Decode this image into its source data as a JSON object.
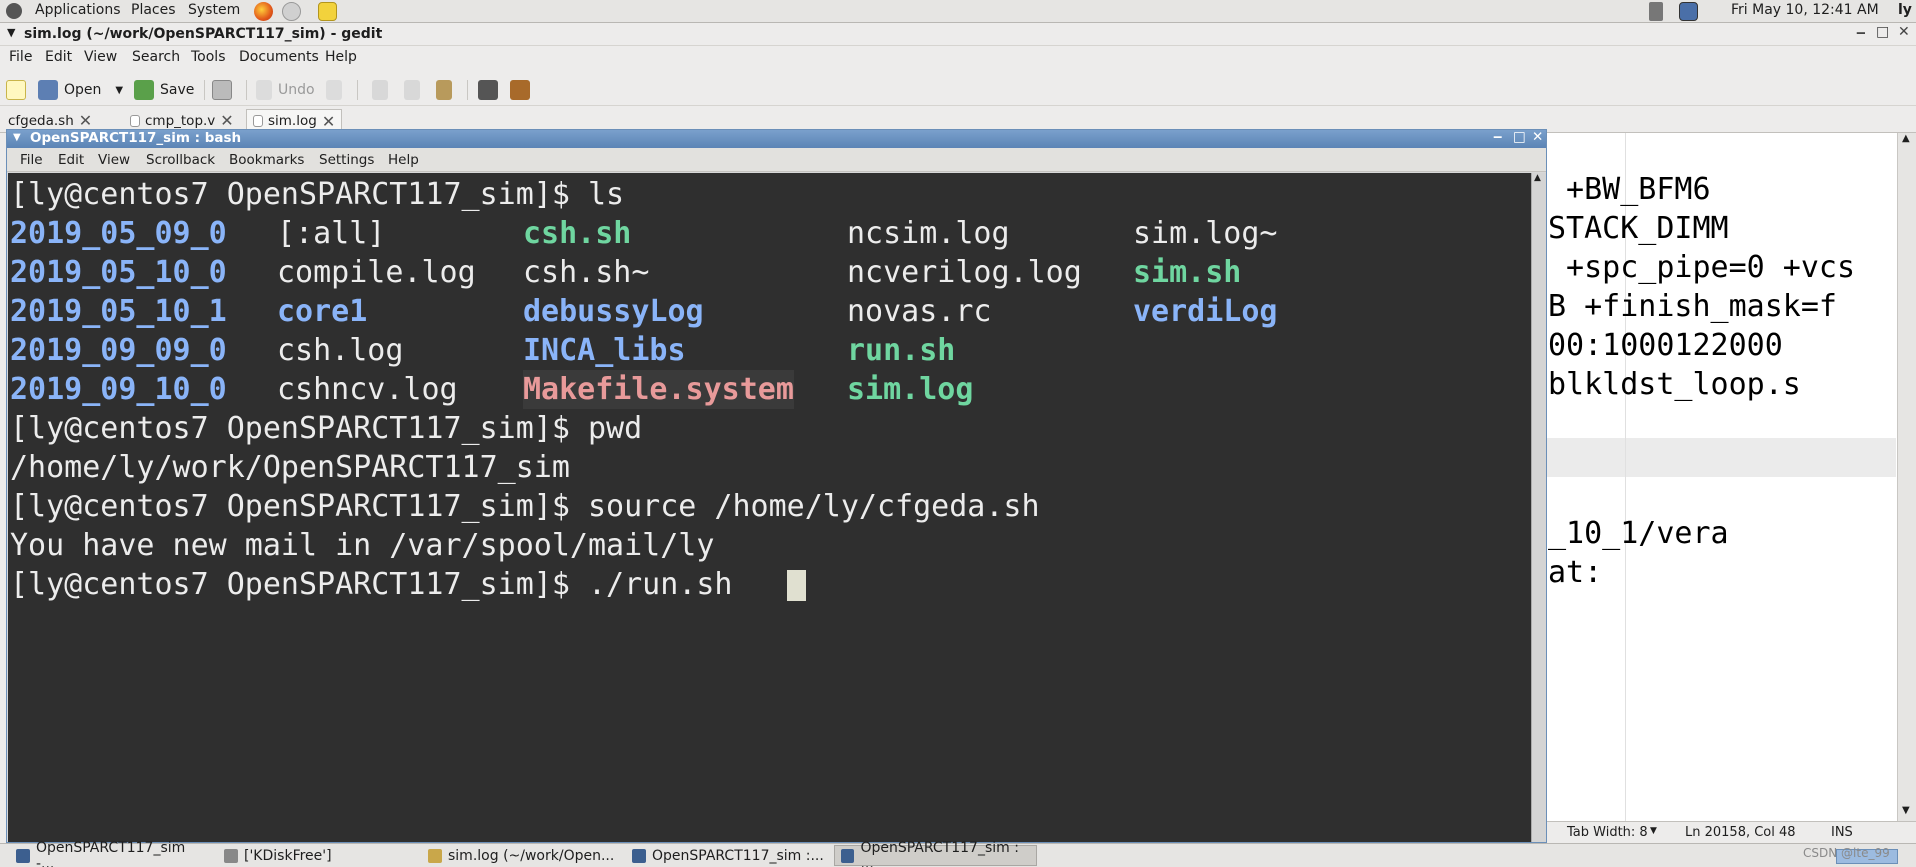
{
  "top_panel": {
    "menus": [
      "Applications",
      "Places",
      "System"
    ],
    "clock": "Fri May 10, 12:41 AM",
    "user": "ly"
  },
  "gedit": {
    "title": "sim.log (~/work/OpenSPARCT117_sim) - gedit",
    "menu": [
      "File",
      "Edit",
      "View",
      "Search",
      "Tools",
      "Documents",
      "Help"
    ],
    "toolbar": {
      "open_label": "Open",
      "save_label": "Save",
      "undo_label": "Undo"
    },
    "tabs": [
      {
        "label": "cfgeda.sh"
      },
      {
        "label": "cmp_top.v"
      },
      {
        "label": "sim.log"
      }
    ],
    "editor_lines": [
      " +BW_BFM6",
      "STACK_DIMM",
      " +spc_pipe=0 +vcs",
      "B +finish_mask=f",
      "00:1000122000",
      "blkldst_loop.s",
      "",
      "",
      "_10_1/vera",
      "at:"
    ],
    "status": {
      "tab_width": "Tab Width: 8",
      "position": "Ln 20158, Col 48",
      "mode": "INS"
    }
  },
  "konsole": {
    "title": "OpenSPARCT117_sim : bash",
    "menu": [
      "File",
      "Edit",
      "View",
      "Scrollback",
      "Bookmarks",
      "Settings",
      "Help"
    ],
    "prompt": "[ly@centos7 OpenSPARCT117_sim]$ ",
    "cmd_ls": "ls",
    "listing": [
      [
        {
          "t": "2019_05_09_0",
          "k": "dir"
        },
        {
          "t": "[:all]",
          "k": "plain"
        },
        {
          "t": "csh.sh",
          "k": "exe"
        },
        {
          "t": "ncsim.log",
          "k": "plain"
        },
        {
          "t": "sim.log~",
          "k": "plain"
        }
      ],
      [
        {
          "t": "2019_05_10_0",
          "k": "dir"
        },
        {
          "t": "compile.log",
          "k": "plain"
        },
        {
          "t": "csh.sh~",
          "k": "plain"
        },
        {
          "t": "ncverilog.log",
          "k": "plain"
        },
        {
          "t": "sim.sh",
          "k": "exe"
        }
      ],
      [
        {
          "t": "2019_05_10_1",
          "k": "dir"
        },
        {
          "t": "core1",
          "k": "dir"
        },
        {
          "t": "debussyLog",
          "k": "dir"
        },
        {
          "t": "novas.rc",
          "k": "plain"
        },
        {
          "t": "verdiLog",
          "k": "dir"
        }
      ],
      [
        {
          "t": "2019_09_09_0",
          "k": "dir"
        },
        {
          "t": "csh.log",
          "k": "plain"
        },
        {
          "t": "INCA_libs",
          "k": "dir"
        },
        {
          "t": "run.sh",
          "k": "exe"
        },
        {
          "t": "",
          "k": "plain"
        }
      ],
      [
        {
          "t": "2019_09_10_0",
          "k": "dir"
        },
        {
          "t": "cshncv.log",
          "k": "plain"
        },
        {
          "t": "Makefile.system",
          "k": "mk"
        },
        {
          "t": "sim.log",
          "k": "exe"
        },
        {
          "t": "",
          "k": "plain"
        }
      ]
    ],
    "cmd_pwd": "pwd",
    "pwd_out": "/home/ly/work/OpenSPARCT117_sim",
    "cmd_source": "source /home/ly/cfgeda.sh",
    "mail_msg": "You have new mail in /var/spool/mail/ly",
    "cmd_run": "./run.sh"
  },
  "taskbar": {
    "items": [
      {
        "label": "OpenSPARCT117_sim -..."
      },
      {
        "label": "['KDiskFree']"
      },
      {
        "label": "sim.log (~/work/Open..."
      },
      {
        "label": "OpenSPARCT117_sim :..."
      },
      {
        "label": "OpenSPARCT117_sim : ..."
      }
    ],
    "watermark": "CSDN @lte_99"
  }
}
